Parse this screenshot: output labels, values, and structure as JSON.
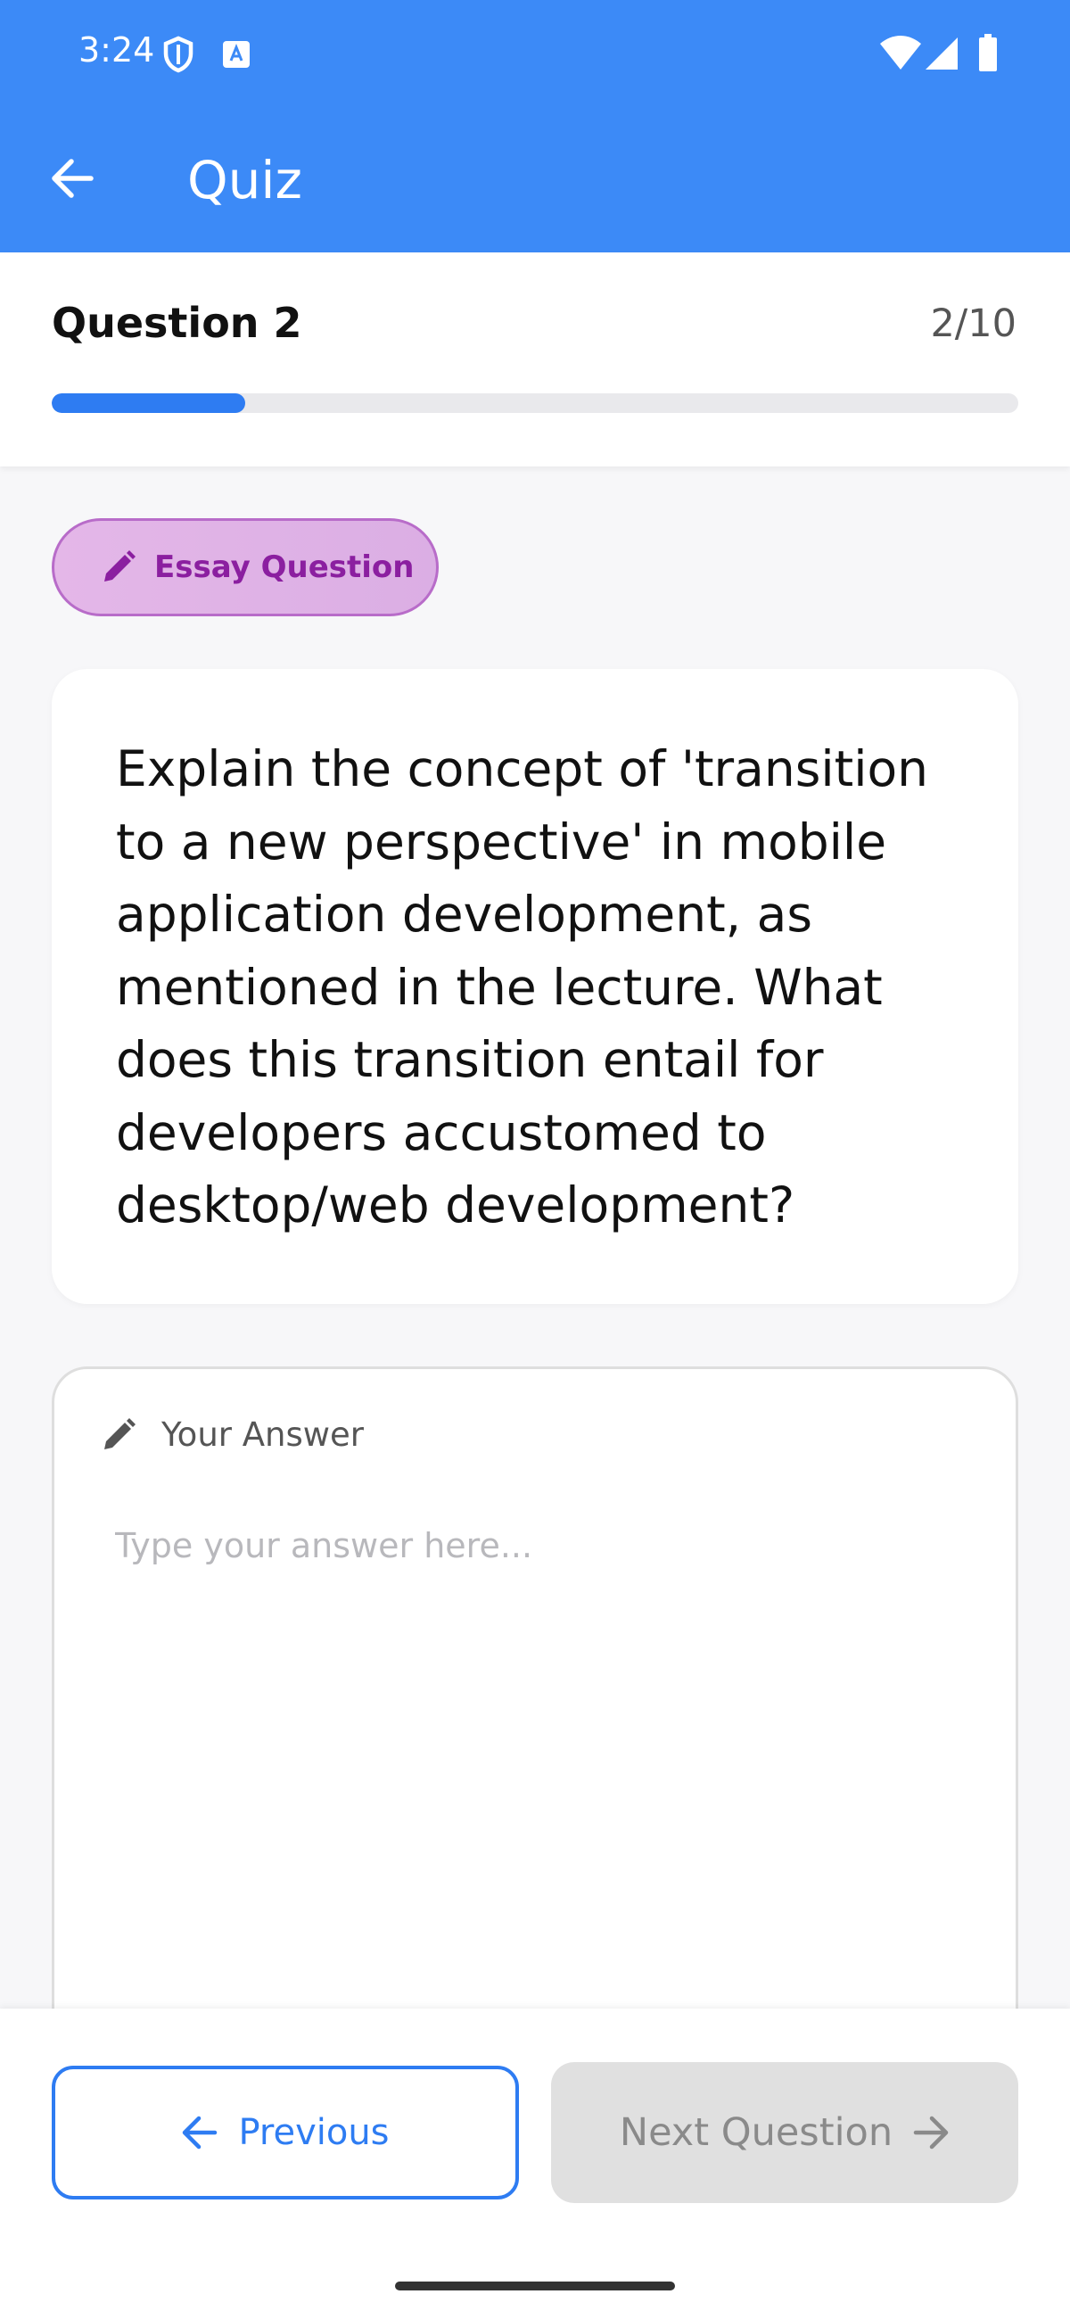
{
  "status_bar": {
    "time": "3:24",
    "icons": [
      "shield-icon",
      "keyboard-a-icon",
      "wifi-icon",
      "cell-signal-icon",
      "battery-icon"
    ]
  },
  "app_bar": {
    "title": "Quiz",
    "back_icon": "arrow-back-icon",
    "background_color": "#3c8af7"
  },
  "progress": {
    "question_title": "Question 2",
    "counter": "2/10",
    "current": 2,
    "total": 10,
    "fraction": 0.2,
    "accent_color": "#2e7cf2"
  },
  "badge": {
    "label": "Essay Question",
    "icon": "pencil-icon",
    "text_color": "#8b1fa0"
  },
  "question": {
    "text": "Explain the concept of 'transition to a new perspective' in mobile application development, as mentioned in the lecture. What does this transition entail for developers accustomed to desktop/web development?"
  },
  "answer": {
    "label": "Your Answer",
    "icon": "pencil-icon",
    "value": "",
    "placeholder": "Type your answer here..."
  },
  "navigation": {
    "previous_label": "Previous",
    "previous_icon": "arrow-left-icon",
    "next_label": "Next Question",
    "next_icon": "arrow-right-icon",
    "next_disabled": true
  }
}
